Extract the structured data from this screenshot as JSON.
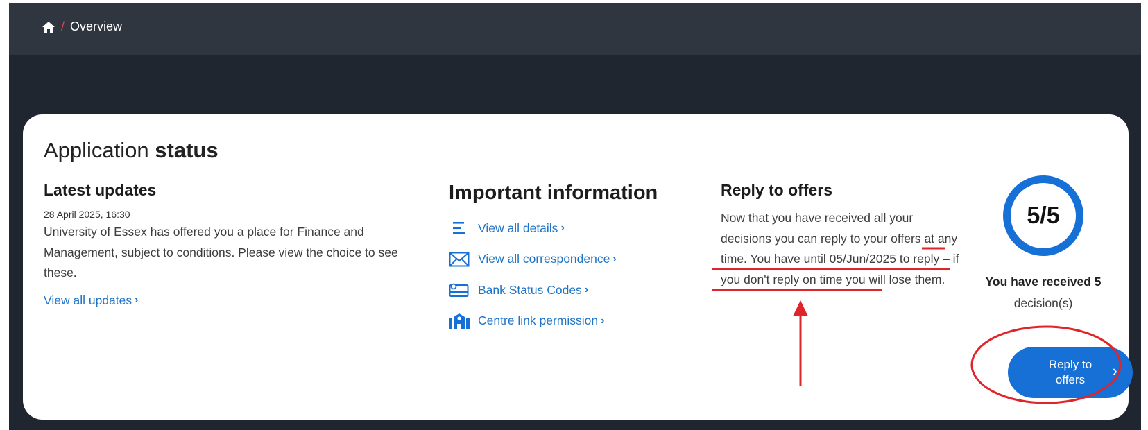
{
  "breadcrumb": {
    "home_icon": "home-icon",
    "separator": "/",
    "current": "Overview"
  },
  "card": {
    "title_light": "Application",
    "title_bold": "status"
  },
  "latest_updates": {
    "heading": "Latest updates",
    "date": "28 April 2025, 16:30",
    "text": "University of Essex has offered you a place for Finance and Management, subject to conditions. Please view the choice to see these.",
    "link": "View all updates"
  },
  "important_information": {
    "heading": "Important information",
    "items": [
      {
        "label": "View all details",
        "icon": "list-icon"
      },
      {
        "label": "View all correspondence",
        "icon": "envelope-icon"
      },
      {
        "label": "Bank Status Codes",
        "icon": "bank-card-icon"
      },
      {
        "label": "Centre link permission",
        "icon": "school-building-icon"
      }
    ]
  },
  "reply_to_offers": {
    "heading": "Reply to offers",
    "text_part1": "Now that you have received all your decisions you can reply to your offers at any time. ",
    "text_part2": "You have until 05/Jun/2025 to reply – if you don't reply on time you will lose them."
  },
  "decisions": {
    "count_display": "5/5",
    "progress_fraction": 1.0,
    "received": "You have received 5",
    "suffix": "decision(s)",
    "button_label": "Reply to offers"
  },
  "colors": {
    "accent": "#1670d6",
    "link": "#1f74c6",
    "annotation": "#e0242b",
    "header_bg": "#2f363f",
    "page_bg": "#1f2630"
  }
}
